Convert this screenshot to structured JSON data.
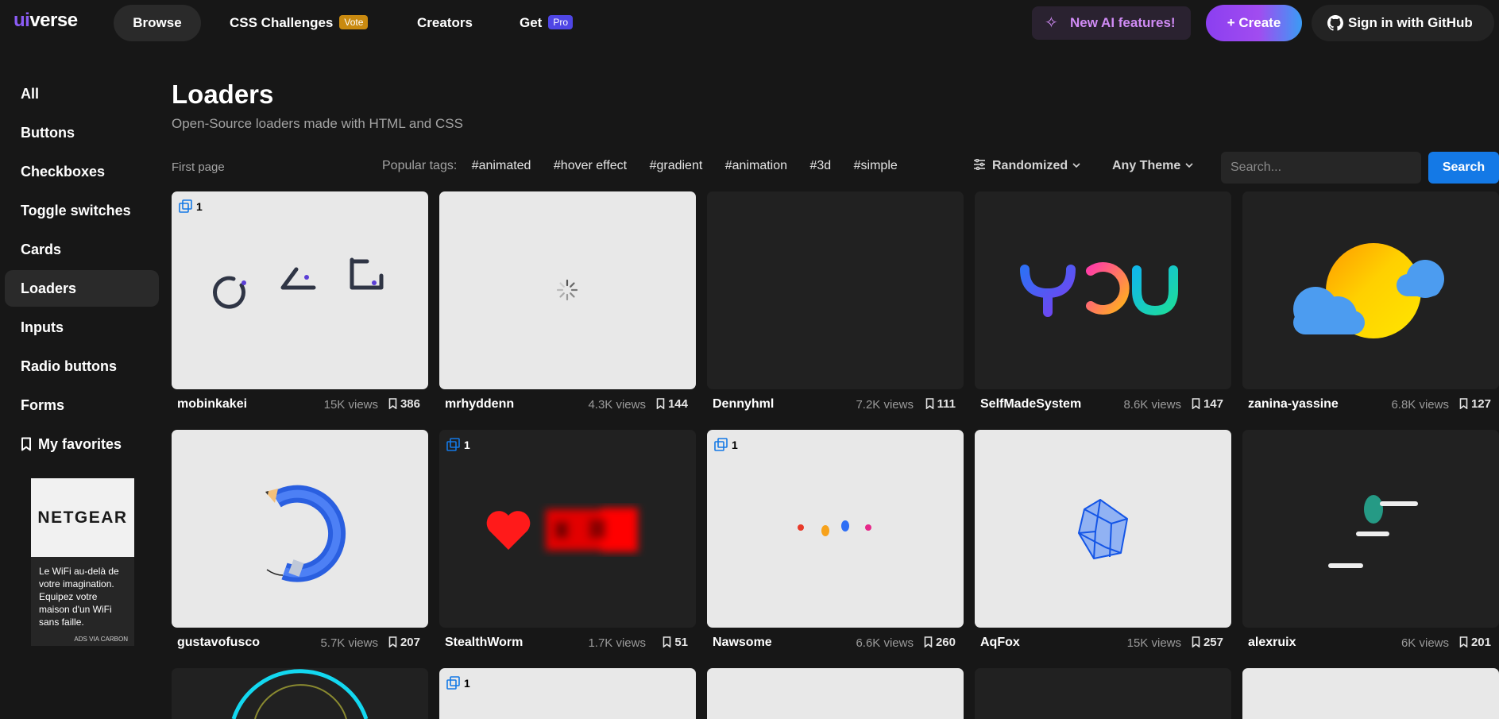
{
  "header": {
    "logo_prefix": "ui",
    "logo_suffix": "verse",
    "nav": {
      "browse": "Browse",
      "challenges": "CSS Challenges",
      "challenges_badge": "Vote",
      "creators": "Creators",
      "get": "Get",
      "get_badge": "Pro"
    },
    "ai_features": "New AI features!",
    "create": "Create",
    "github": "Sign in with GitHub"
  },
  "sidebar": {
    "items": [
      {
        "label": "All"
      },
      {
        "label": "Buttons"
      },
      {
        "label": "Checkboxes"
      },
      {
        "label": "Toggle switches"
      },
      {
        "label": "Cards"
      },
      {
        "label": "Loaders"
      },
      {
        "label": "Inputs"
      },
      {
        "label": "Radio buttons"
      },
      {
        "label": "Forms"
      }
    ],
    "active": "Loaders",
    "favorites": "My favorites"
  },
  "ad": {
    "brand": "NETGEAR",
    "text": "Le WiFi au-delà de votre imagination. Equipez votre maison d'un WiFi sans faille.",
    "via": "ADS VIA CARBON"
  },
  "main": {
    "title": "Loaders",
    "subtitle": "Open-Source loaders made with HTML and CSS",
    "first_page": "First page",
    "popular_label": "Popular tags:",
    "tags": [
      "#animated",
      "#hover effect",
      "#gradient",
      "#animation",
      "#3d",
      "#simple"
    ],
    "sort": "Randomized",
    "theme": "Any Theme",
    "search_placeholder": "Search...",
    "search_button": "Search"
  },
  "cards": [
    {
      "author": "mobinkakei",
      "views": "15K views",
      "saves": "386",
      "variants": "1"
    },
    {
      "author": "mrhyddenn",
      "views": "4.3K views",
      "saves": "144"
    },
    {
      "author": "Dennyhml",
      "views": "7.2K views",
      "saves": "111"
    },
    {
      "author": "SelfMadeSystem",
      "views": "8.6K views",
      "saves": "147",
      "art_text": "YOU"
    },
    {
      "author": "zanina-yassine",
      "views": "6.8K views",
      "saves": "127"
    },
    {
      "author": "gustavofusco",
      "views": "5.7K views",
      "saves": "207"
    },
    {
      "author": "StealthWorm",
      "views": "1.7K views",
      "saves": "51",
      "variants": "1"
    },
    {
      "author": "Nawsome",
      "views": "6.6K views",
      "saves": "260",
      "variants": "1"
    },
    {
      "author": "AqFox",
      "views": "15K views",
      "saves": "257"
    },
    {
      "author": "alexruix",
      "views": "6K views",
      "saves": "201"
    },
    {
      "variants": "1"
    }
  ],
  "colors": {
    "accent": "#8b5cf6",
    "search_button": "#1479e6",
    "vote_badge": "#c98a10",
    "pro_badge": "#4f46e5"
  }
}
